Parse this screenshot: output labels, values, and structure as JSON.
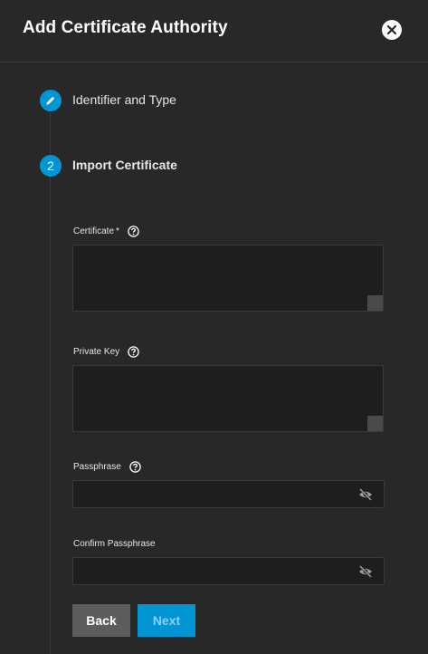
{
  "dialog": {
    "title": "Add Certificate Authority"
  },
  "steps": [
    {
      "label": "Identifier and Type",
      "state": "completed",
      "icon": "pencil-icon"
    },
    {
      "label": "Import Certificate",
      "state": "active",
      "number": "2"
    }
  ],
  "form": {
    "certificate": {
      "label": "Certificate",
      "required_mark": "*",
      "value": ""
    },
    "private_key": {
      "label": "Private Key",
      "value": ""
    },
    "passphrase": {
      "label": "Passphrase",
      "value": ""
    },
    "confirm_passphrase": {
      "label": "Confirm Passphrase",
      "value": ""
    }
  },
  "buttons": {
    "back": "Back",
    "next": "Next"
  },
  "colors": {
    "accent": "#0095d5",
    "background": "#282828",
    "field_background": "#1e1e1e"
  }
}
